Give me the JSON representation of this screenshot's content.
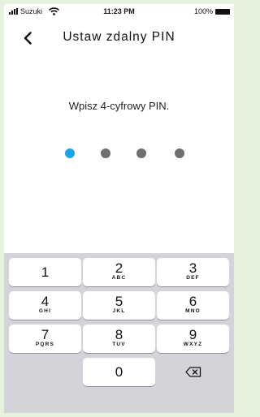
{
  "status_bar": {
    "carrier": "Suzuki",
    "time": "11:23 PM",
    "battery": "100%"
  },
  "header": {
    "title": "Ustaw zdalny PIN"
  },
  "prompt": "Wpisz 4-cyfrowy PIN.",
  "pin": {
    "length": 4,
    "entered": 1,
    "active_color": "#1fa3e8",
    "inactive_color": "#6f6f6f"
  },
  "keypad": {
    "keys": [
      {
        "digit": "1",
        "letters": ""
      },
      {
        "digit": "2",
        "letters": "ABC"
      },
      {
        "digit": "3",
        "letters": "DEF"
      },
      {
        "digit": "4",
        "letters": "GHI"
      },
      {
        "digit": "5",
        "letters": "JKL"
      },
      {
        "digit": "6",
        "letters": "MNO"
      },
      {
        "digit": "7",
        "letters": "PQRS"
      },
      {
        "digit": "8",
        "letters": "TUV"
      },
      {
        "digit": "9",
        "letters": "WXYZ"
      },
      {
        "digit": "0",
        "letters": ""
      }
    ],
    "delete_icon": "backspace-icon"
  },
  "colors": {
    "page_background": "#e6f2dd",
    "keypad_background": "#d2d4d9"
  }
}
